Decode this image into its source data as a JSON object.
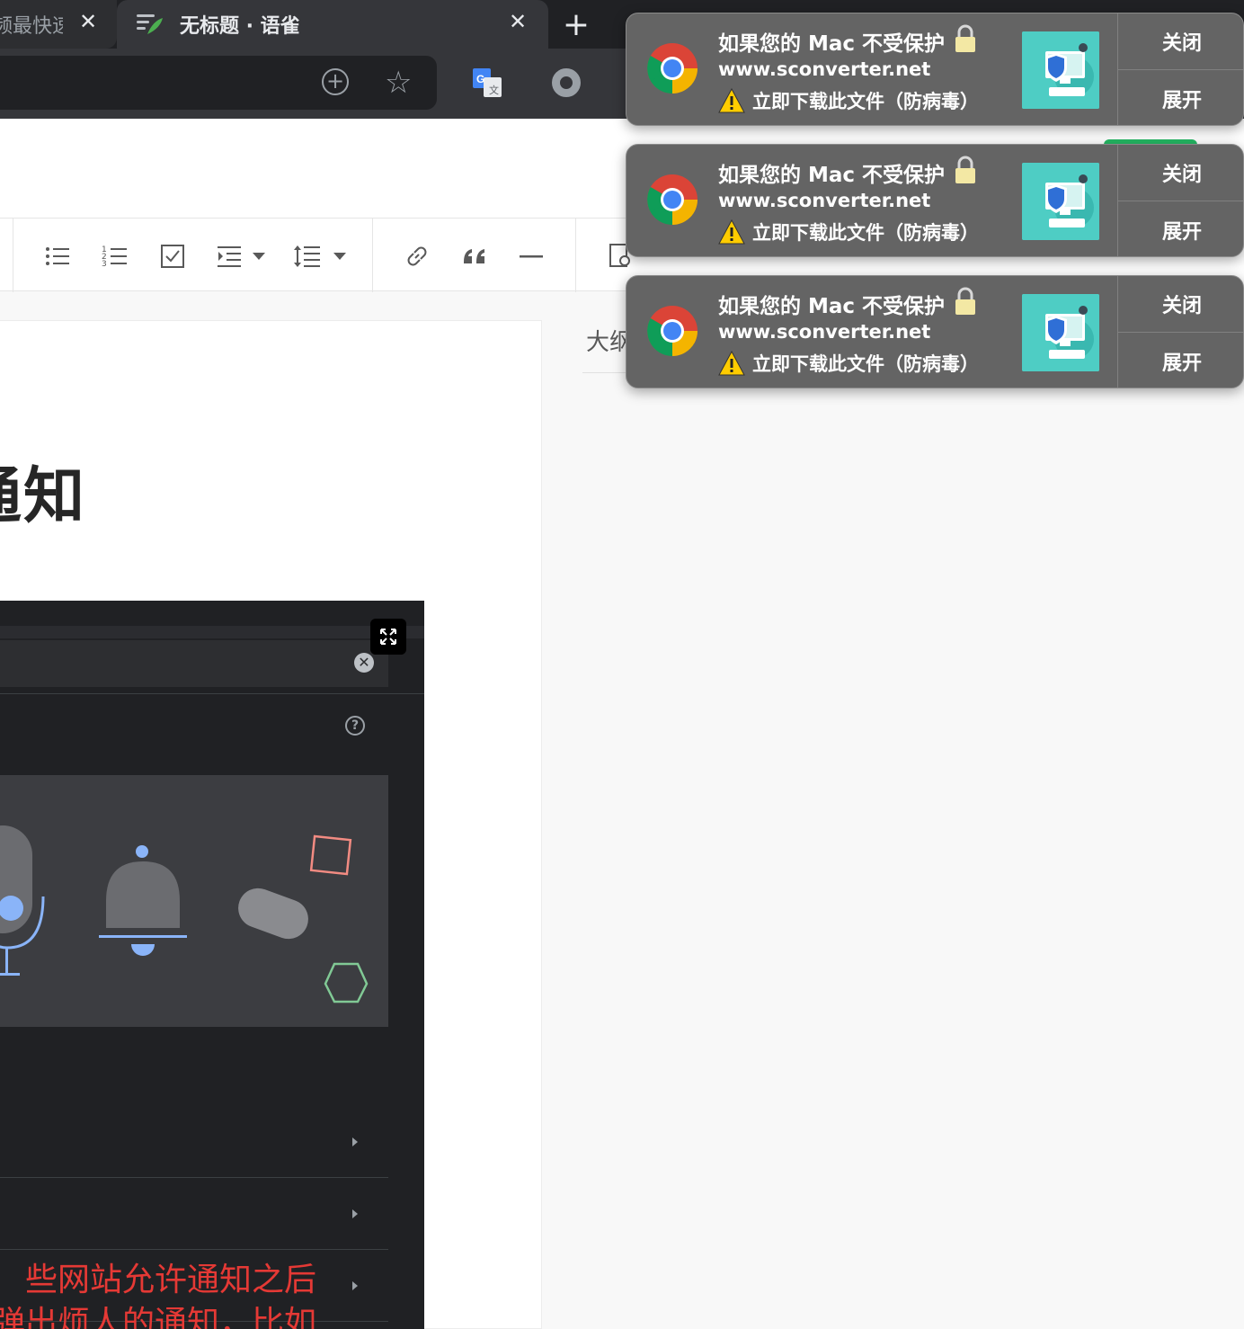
{
  "browser": {
    "tabs": [
      {
        "title": "频最快速",
        "active": false
      },
      {
        "title": "无标题 · 语雀",
        "active": true
      }
    ],
    "tab_close_glyph": "✕",
    "new_tab_glyph": "+",
    "icons": [
      "add-circle-icon",
      "star-add-icon",
      "google-translate-icon",
      "record-icon"
    ]
  },
  "editor": {
    "heading_fragment": "通知",
    "outline_label": "大纲",
    "toolbar_icons": [
      "bulleted-list-icon",
      "numbered-list-icon",
      "task-list-icon",
      "indent-icon",
      "line-spacing-icon",
      "link-icon",
      "quote-icon",
      "divider-icon",
      "search-doc-icon"
    ]
  },
  "embedded_screenshot": {
    "clear_glyph": "✕",
    "help_glyph": "?",
    "caption_lines": [
      "些网站允许通知之后",
      "弹出烦人的通知，比如"
    ]
  },
  "notifications": [
    {
      "title": "如果您的 Mac 不受保护",
      "site": "www.sconverter.net",
      "body": "立即下载此文件（防病毒）",
      "close_label": "关闭",
      "expand_label": "展开"
    },
    {
      "title": "如果您的 Mac 不受保护",
      "site": "www.sconverter.net",
      "body": "立即下载此文件（防病毒）",
      "close_label": "关闭",
      "expand_label": "展开"
    },
    {
      "title": "如果您的 Mac 不受保护",
      "site": "www.sconverter.net",
      "body": "立即下载此文件（防病毒）",
      "close_label": "关闭",
      "expand_label": "展开"
    }
  ],
  "colors": {
    "chrome_dark": "#202124",
    "notification_bg": "#646464",
    "thumb_teal": "#4ecdc4",
    "caption_red": "#e53935",
    "brand_green": "#25b864"
  }
}
